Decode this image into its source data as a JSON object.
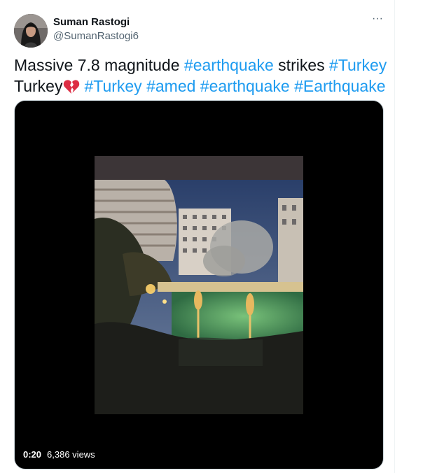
{
  "tweet": {
    "author": {
      "display_name": "Suman Rastogi",
      "handle": "@SumanRastogi6"
    },
    "more_icon": "ellipsis-icon",
    "text": {
      "line1_plain1": "Massive 7.8 magnitude ",
      "line1_tag1": "#earthquake",
      "line1_plain2": " strikes ",
      "line1_tag2": "#Turkey",
      "line2_plain": "Turkey",
      "emoji": "broken-heart-emoji",
      "tags": [
        "#Turkey",
        "#amed",
        "#earthquake",
        "#Earthquake"
      ]
    },
    "video": {
      "duration": "0:20",
      "views": "6,386 views"
    }
  },
  "colors": {
    "link": "#1d9bf0",
    "text": "#0f1419",
    "secondary": "#536471",
    "media_bg": "#000000"
  }
}
